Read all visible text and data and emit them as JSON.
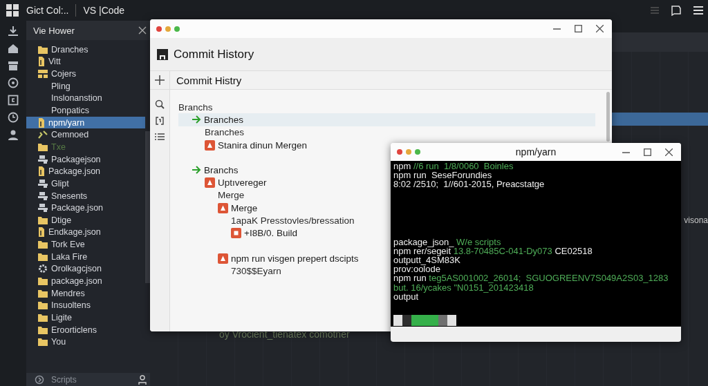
{
  "app": {
    "title": "Gict Col:..",
    "product": "VS |Code"
  },
  "sidebar": {
    "title": "Vie Hower",
    "footer": "Scripts",
    "items": [
      {
        "label": "Dranches",
        "kind": "folder",
        "selected": false,
        "dimmed": false
      },
      {
        "label": "Vitt",
        "kind": "file",
        "selected": false,
        "dimmed": false
      },
      {
        "label": "Cojers",
        "kind": "blocks",
        "selected": false,
        "dimmed": false
      },
      {
        "label": "Pling",
        "kind": "text",
        "selected": false,
        "dimmed": false
      },
      {
        "label": "Inslonanstion",
        "kind": "text",
        "selected": false,
        "dimmed": false
      },
      {
        "label": "Ponpatics",
        "kind": "text",
        "selected": false,
        "dimmed": false
      },
      {
        "label": "npm/yarn",
        "kind": "file",
        "selected": true,
        "dimmed": false
      },
      {
        "label": "Cemnoed",
        "kind": "tool",
        "selected": false,
        "dimmed": false
      },
      {
        "label": "Txe",
        "kind": "folder",
        "selected": false,
        "dimmed": true
      },
      {
        "label": "Packagejson",
        "kind": "db",
        "selected": false,
        "dimmed": false
      },
      {
        "label": "Package.json",
        "kind": "file",
        "selected": false,
        "dimmed": false
      },
      {
        "label": "Glipt",
        "kind": "db",
        "selected": false,
        "dimmed": false
      },
      {
        "label": "Snesents",
        "kind": "db",
        "selected": false,
        "dimmed": false
      },
      {
        "label": "Package.json",
        "kind": "db",
        "selected": false,
        "dimmed": false
      },
      {
        "label": "Dtige",
        "kind": "folder",
        "selected": false,
        "dimmed": false
      },
      {
        "label": "Endkage.json",
        "kind": "file",
        "selected": false,
        "dimmed": false
      },
      {
        "label": "Tork Eve",
        "kind": "folder",
        "selected": false,
        "dimmed": false
      },
      {
        "label": "Laka Fire",
        "kind": "folder",
        "selected": false,
        "dimmed": false
      },
      {
        "label": "Orolkagcjson",
        "kind": "gear",
        "selected": false,
        "dimmed": false
      },
      {
        "label": "package.json",
        "kind": "folder",
        "selected": false,
        "dimmed": false
      },
      {
        "label": "Mendres",
        "kind": "folder",
        "selected": false,
        "dimmed": false
      },
      {
        "label": "Insuoltens",
        "kind": "folder",
        "selected": false,
        "dimmed": false
      },
      {
        "label": "Ligite",
        "kind": "folder",
        "selected": false,
        "dimmed": false
      },
      {
        "label": "Eroorticlens",
        "kind": "folder",
        "selected": false,
        "dimmed": false
      },
      {
        "label": "You",
        "kind": "folder",
        "selected": false,
        "dimmed": false
      }
    ]
  },
  "editor": {
    "caption": "oy Vrocient_tienatex comotner",
    "side_text": "visona"
  },
  "commit_window": {
    "title": "Commit History",
    "subtitle": "Commit Histry",
    "tree": [
      {
        "label": "Branchs",
        "kind": "plain",
        "selected": false,
        "children": [
          {
            "label": "Branches",
            "kind": "arrow",
            "selected": true,
            "children": [
              {
                "label": "Branches",
                "kind": "plain",
                "selected": false
              },
              {
                "label": "Stanira dinun Mergen",
                "kind": "alert",
                "selected": false
              }
            ]
          },
          {
            "label": "Branchs",
            "kind": "arrow",
            "selected": false,
            "children": [
              {
                "label": "Uptıvereger",
                "kind": "alert",
                "selected": false,
                "children": [
                  {
                    "label": "Merge",
                    "kind": "plain",
                    "selected": false
                  },
                  {
                    "label": "Merge",
                    "kind": "alert",
                    "selected": false,
                    "children": [
                      {
                        "label": "1apaK Presstovles/bressation",
                        "kind": "plain",
                        "selected": false
                      },
                      {
                        "label": "+I8B/0. Build",
                        "kind": "build",
                        "selected": false
                      }
                    ]
                  },
                  {
                    "label": "npm run visgen prepert dscipts",
                    "kind": "alert",
                    "selected": false,
                    "children": [
                      {
                        "label": "730$$Eyarn",
                        "kind": "plain",
                        "selected": false
                      }
                    ]
                  }
                ]
              }
            ]
          }
        ]
      }
    ]
  },
  "terminal": {
    "title": "npm/yarn",
    "groups": [
      {
        "lines": [
          [
            {
              "text": "npm",
              "kind": "plain"
            },
            {
              "text": "//6 run  1/8/0060  Boinles",
              "kind": "green"
            }
          ],
          [
            {
              "text": "npm run  SeseForundies",
              "kind": "plain"
            }
          ],
          [
            {
              "text": "8:02 /2510;  1//601-2015, Preacstatge",
              "kind": "plain"
            }
          ]
        ]
      },
      {
        "lines": [
          [
            {
              "text": "package_json_",
              "kind": "plain"
            },
            {
              "text": "W/e scripts",
              "kind": "green"
            }
          ],
          [
            {
              "text": "npm rer/segeit",
              "kind": "plain"
            },
            {
              "text": "13.8-70485C-041-Dy073",
              "kind": "green"
            },
            {
              "text": "CE02518",
              "kind": "plain"
            }
          ],
          [
            {
              "text": "outputt_4SM83K",
              "kind": "plain"
            }
          ],
          [
            {
              "text": "prov:oolode",
              "kind": "plain"
            }
          ],
          [
            {
              "text": "npm run",
              "kind": "plain"
            },
            {
              "text": "teg5AS001002_26014;  SGUOGREENV7S049A2S03_1283",
              "kind": "green"
            }
          ],
          [
            {
              "text": "but. 16/ycakes \"N0151_201423418",
              "kind": "green"
            }
          ],
          [
            {
              "text": "output",
              "kind": "plain"
            }
          ]
        ]
      }
    ],
    "blocks": [
      {
        "color": "#e2e2e2"
      },
      {
        "color": "#2e2e2e"
      },
      {
        "color": "#35b04a"
      },
      {
        "color": "#35b04a"
      },
      {
        "color": "#35b04a"
      },
      {
        "color": "#707070"
      },
      {
        "color": "#e2e2e2"
      }
    ]
  }
}
